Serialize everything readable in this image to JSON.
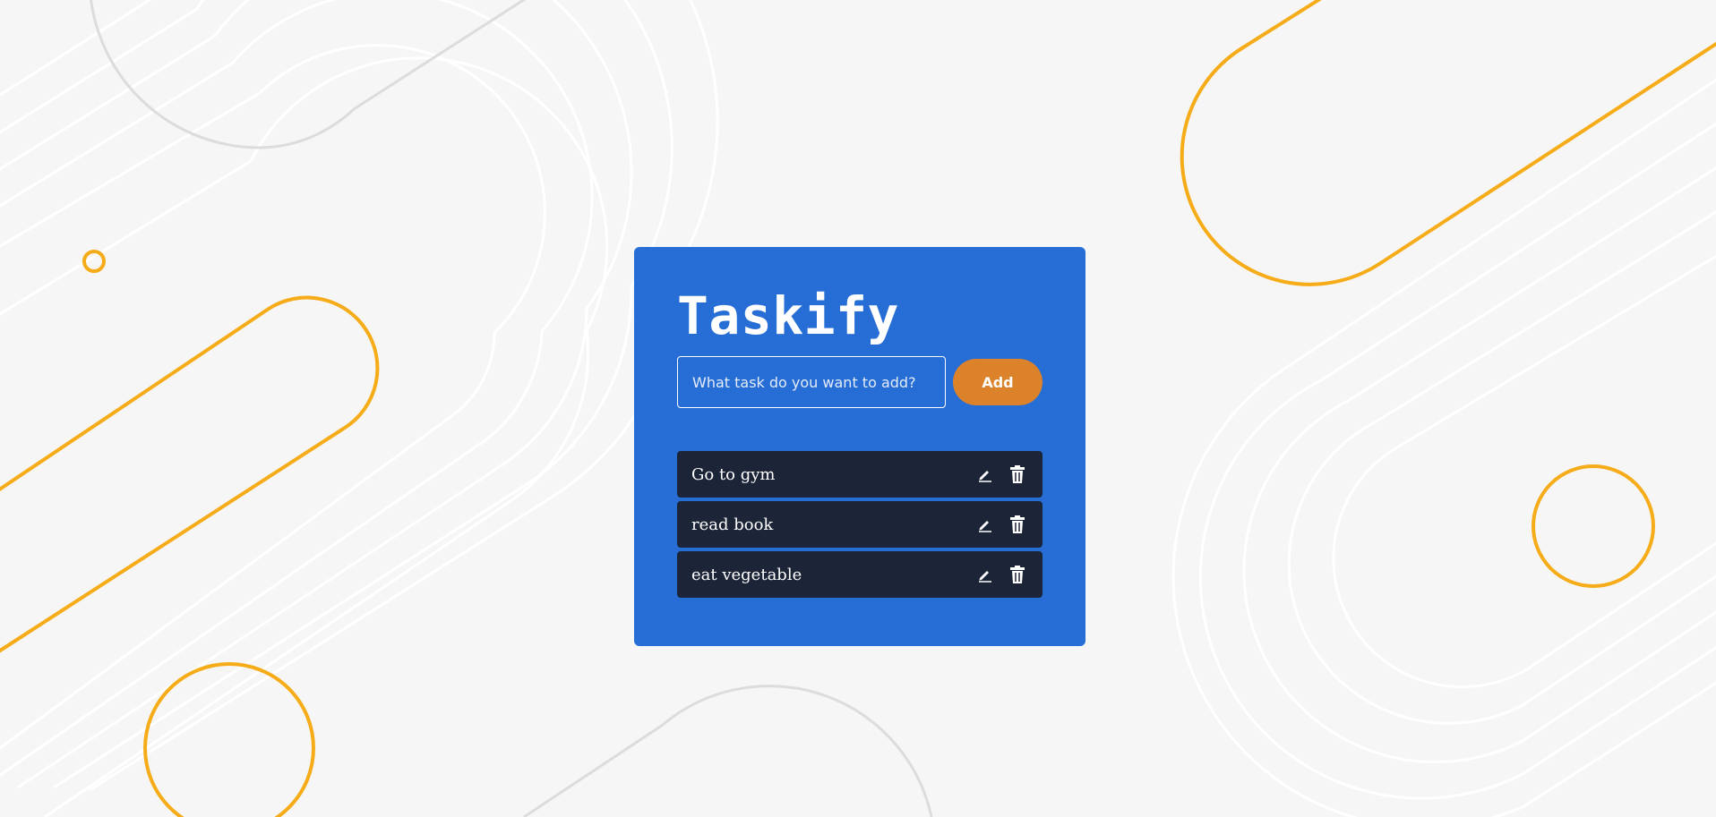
{
  "app": {
    "title": "Taskify"
  },
  "form": {
    "input_value": "",
    "input_placeholder": "What task do you want to add?",
    "add_label": "Add"
  },
  "tasks": [
    {
      "text": "Go to gym"
    },
    {
      "text": "read book"
    },
    {
      "text": "eat vegetable"
    }
  ],
  "task_actions": {
    "edit_icon": "pencil-icon",
    "delete_icon": "trash-icon"
  },
  "colors": {
    "background": "#f6f6f6",
    "card": "#266ed5",
    "accent": "#db822a",
    "task_item": "#1c2438",
    "decor_orange": "#f5ac18",
    "decor_white": "#ffffff",
    "decor_grey": "#dcdcdc"
  }
}
